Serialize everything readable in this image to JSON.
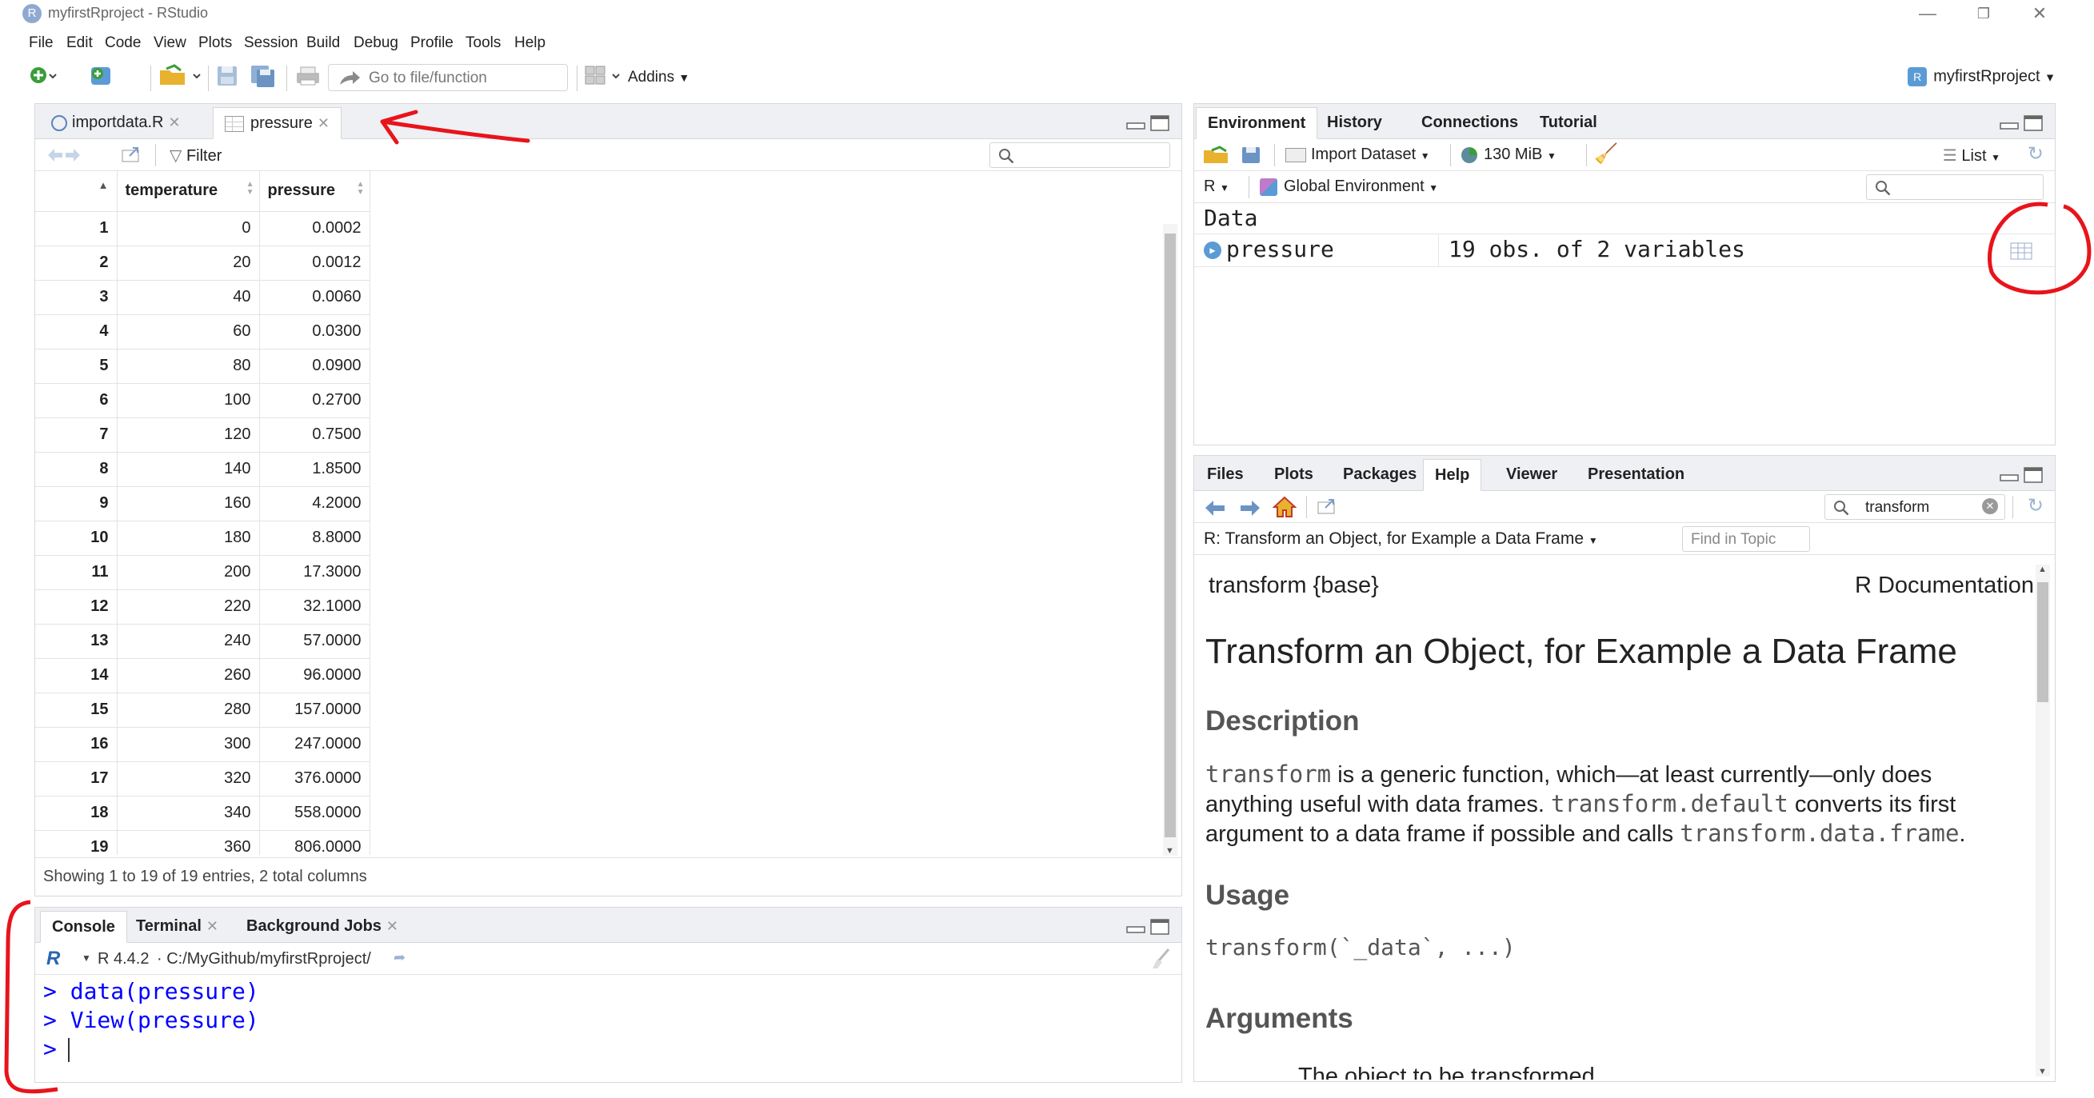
{
  "window": {
    "title": "myfirstRproject - RStudio",
    "logo_letter": "R",
    "minimize": "—",
    "maximize": "❐",
    "close": "✕"
  },
  "menu": [
    "File",
    "Edit",
    "Code",
    "View",
    "Plots",
    "Session",
    "Build",
    "Debug",
    "Profile",
    "Tools",
    "Help"
  ],
  "toolbar": {
    "goto_placeholder": "Go to file/function",
    "addins_label": "Addins",
    "project_label": "myfirstRproject"
  },
  "source_pane": {
    "tabs": [
      {
        "label": "importdata.R"
      },
      {
        "label": "pressure"
      }
    ],
    "filter_label": "Filter",
    "columns": [
      "temperature",
      "pressure"
    ],
    "rows": [
      [
        "1",
        "0",
        "0.0002"
      ],
      [
        "2",
        "20",
        "0.0012"
      ],
      [
        "3",
        "40",
        "0.0060"
      ],
      [
        "4",
        "60",
        "0.0300"
      ],
      [
        "5",
        "80",
        "0.0900"
      ],
      [
        "6",
        "100",
        "0.2700"
      ],
      [
        "7",
        "120",
        "0.7500"
      ],
      [
        "8",
        "140",
        "1.8500"
      ],
      [
        "9",
        "160",
        "4.2000"
      ],
      [
        "10",
        "180",
        "8.8000"
      ],
      [
        "11",
        "200",
        "17.3000"
      ],
      [
        "12",
        "220",
        "32.1000"
      ],
      [
        "13",
        "240",
        "57.0000"
      ],
      [
        "14",
        "260",
        "96.0000"
      ],
      [
        "15",
        "280",
        "157.0000"
      ],
      [
        "16",
        "300",
        "247.0000"
      ],
      [
        "17",
        "320",
        "376.0000"
      ],
      [
        "18",
        "340",
        "558.0000"
      ],
      [
        "19",
        "360",
        "806.0000"
      ]
    ],
    "status": "Showing 1 to 19 of 19 entries, 2 total columns"
  },
  "env_pane": {
    "tabs": [
      "Environment",
      "History",
      "Connections",
      "Tutorial"
    ],
    "import_label": "Import Dataset",
    "memory_label": "130 MiB",
    "list_label": "List",
    "lang_label": "R",
    "scope_label": "Global Environment",
    "section_title": "Data",
    "item_name": "pressure",
    "item_value": "19 obs. of 2 variables"
  },
  "help_pane": {
    "tabs": [
      "Files",
      "Plots",
      "Packages",
      "Help",
      "Viewer",
      "Presentation"
    ],
    "search_value": "transform",
    "topic_label": "R: Transform an Object, for Example a Data Frame",
    "find_placeholder": "Find in Topic",
    "doc": {
      "pkg": "transform {base}",
      "rdoc": "R Documentation",
      "title": "Transform an Object, for Example a Data Frame",
      "h_description": "Description",
      "desc_code1": "transform",
      "desc_t1": " is a generic function, which—at least currently—only does anything useful with data frames. ",
      "desc_code2": "transform.default",
      "desc_t2": " converts its first argument to a data frame if possible and calls ",
      "desc_code3": "transform.data.frame",
      "desc_t3": ".",
      "h_usage": "Usage",
      "usage_code": "transform(`_data`, ...)",
      "h_arguments": "Arguments",
      "arg_partial": "The object to be transformed"
    }
  },
  "console_pane": {
    "tabs": [
      "Console",
      "Terminal",
      "Background Jobs"
    ],
    "version": "R 4.4.2",
    "path": "· C:/MyGithub/myfirstRproject/",
    "lines": [
      "> data(pressure)",
      "> View(pressure)",
      ">"
    ]
  },
  "colors": {
    "annotation": "#e8141b",
    "console_text": "#0000ff",
    "accent_green": "#3a9d3a"
  }
}
